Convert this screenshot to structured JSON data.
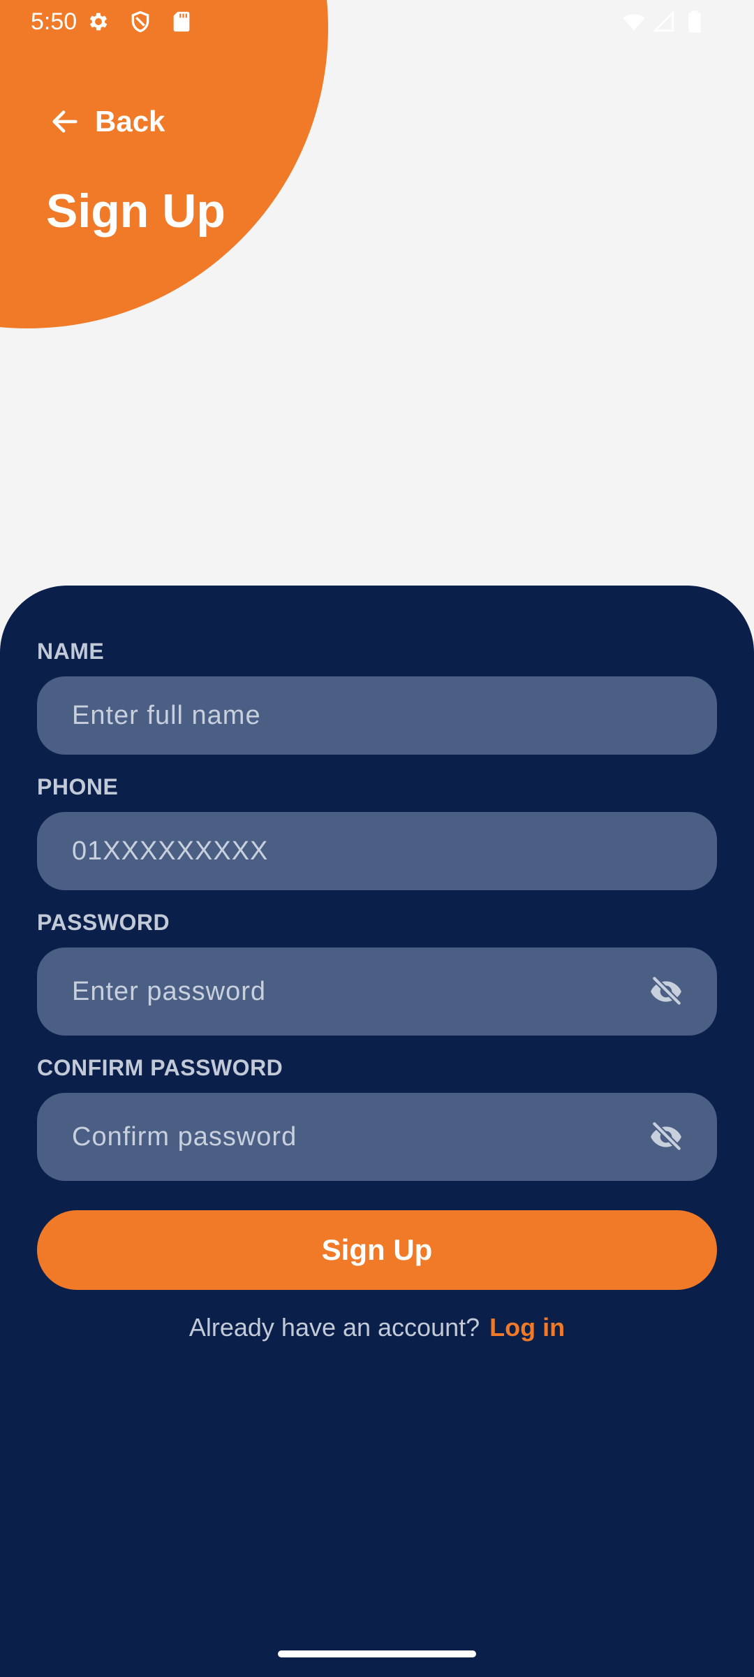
{
  "status_bar": {
    "time": "5:50",
    "left_icons": [
      "gear-icon",
      "shield-icon",
      "sd-card-icon"
    ],
    "right_icons": [
      "wifi-icon",
      "signal-icon",
      "battery-icon"
    ]
  },
  "header": {
    "back_label": "Back",
    "title": "Sign Up"
  },
  "form": {
    "name": {
      "label": "NAME",
      "placeholder": "Enter full name",
      "value": ""
    },
    "phone": {
      "label": "PHONE",
      "placeholder": "01XXXXXXXXX",
      "value": ""
    },
    "password": {
      "label": "PASSWORD",
      "placeholder": "Enter password",
      "value": "",
      "toggle_icon": "eye-off-icon"
    },
    "confirm_password": {
      "label": "CONFIRM PASSWORD",
      "placeholder": "Confirm password",
      "value": "",
      "toggle_icon": "eye-off-icon"
    },
    "submit_label": "Sign Up",
    "login_prompt": "Already have an account?",
    "login_link": "Log in"
  },
  "colors": {
    "accent": "#F07A28",
    "panel": "#0B1F4B",
    "input_bg": "#4B5F84",
    "background": "#F4F4F4"
  }
}
